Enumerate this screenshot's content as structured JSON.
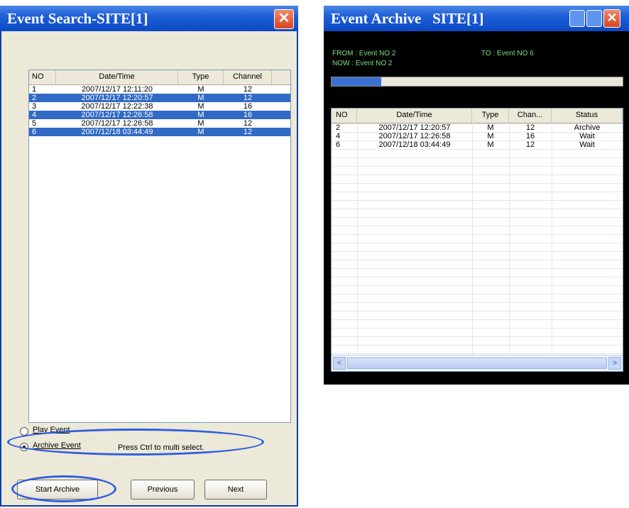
{
  "event_search": {
    "title": "Event Search-SITE[1]",
    "close_glyph": "✕",
    "columns": [
      "NO",
      "Date/Time",
      "Type",
      "Channel"
    ],
    "rows": [
      {
        "no": "1",
        "datetime": "2007/12/17 12:11:20",
        "type": "M",
        "channel": "12",
        "selected": false
      },
      {
        "no": "2",
        "datetime": "2007/12/17 12:20:57",
        "type": "M",
        "channel": "12",
        "selected": true
      },
      {
        "no": "3",
        "datetime": "2007/12/17 12:22:38",
        "type": "M",
        "channel": "16",
        "selected": false
      },
      {
        "no": "4",
        "datetime": "2007/12/17 12:26:58",
        "type": "M",
        "channel": "16",
        "selected": true
      },
      {
        "no": "5",
        "datetime": "2007/12/17 12:26:58",
        "type": "M",
        "channel": "12",
        "selected": false
      },
      {
        "no": "6",
        "datetime": "2007/12/18 03:44:49",
        "type": "M",
        "channel": "12",
        "selected": true
      }
    ],
    "radio_play": "Play Event",
    "radio_archive": "Archive Event",
    "selected_mode": "Archive Event",
    "hint": "Press Ctrl to multi select.",
    "btn_start": "Start Archive",
    "btn_previous": "Previous",
    "btn_next": "Next"
  },
  "event_archive": {
    "title": "Event Archive   SITE[1]",
    "from_label": "FROM : Event NO 2",
    "to_label": "TO : Event NO 6",
    "now_label": "NOW :  Event NO 2",
    "progress": 0.17,
    "columns": [
      "NO",
      "Date/Time",
      "Type",
      "Chan...",
      "Status"
    ],
    "rows": [
      {
        "no": "2",
        "datetime": "2007/12/17 12:20:57",
        "type": "M",
        "channel": "12",
        "status": "Archive"
      },
      {
        "no": "4",
        "datetime": "2007/12/17 12:26:58",
        "type": "M",
        "channel": "16",
        "status": "Wait"
      },
      {
        "no": "6",
        "datetime": "2007/12/18 03:44:49",
        "type": "M",
        "channel": "12",
        "status": "Wait"
      }
    ],
    "scroll_left_glyph": "<",
    "scroll_right_glyph": ">",
    "close_glyph": "✕"
  },
  "colors": {
    "titlebar": "#1f5fd6",
    "selection": "#316ac5",
    "annotation": "#2f5fe0",
    "info_text": "#7fe07f"
  }
}
